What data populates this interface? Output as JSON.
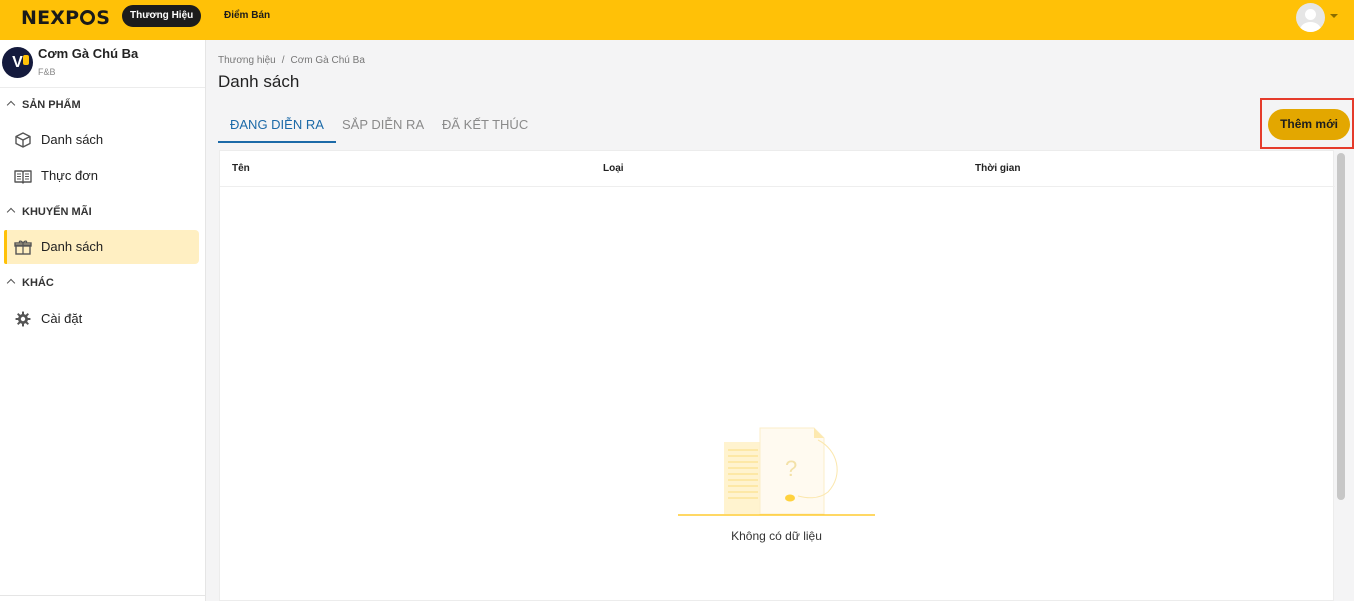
{
  "topbar": {
    "logo_left": "NEXP",
    "logo_right": "S",
    "nav": {
      "active": "Thương Hiệu",
      "other": "Điểm Bán"
    }
  },
  "brand": {
    "name": "Cơm Gà Chú Ba",
    "type": "F&B",
    "logo_letter": "V"
  },
  "sidebar": {
    "sections": [
      {
        "title": "SẢN PHẨM",
        "items": [
          {
            "label": "Danh sách",
            "icon": "cube-icon"
          },
          {
            "label": "Thực đơn",
            "icon": "book-icon"
          }
        ]
      },
      {
        "title": "KHUYẾN MÃI",
        "items": [
          {
            "label": "Danh sách",
            "icon": "gift-icon",
            "active": true
          }
        ]
      },
      {
        "title": "KHÁC",
        "items": [
          {
            "label": "Cài đặt",
            "icon": "gear-icon"
          }
        ]
      }
    ]
  },
  "breadcrumb": {
    "root": "Thương hiệu",
    "separator": "/",
    "current": "Cơm Gà Chú Ba"
  },
  "page": {
    "title": "Danh sách"
  },
  "tabs": [
    {
      "label": "ĐANG DIỄN RA",
      "active": true
    },
    {
      "label": "SẮP DIỄN RA",
      "active": false
    },
    {
      "label": "ĐÃ KẾT THÚC",
      "active": false
    }
  ],
  "actions": {
    "add_label": "Thêm mới"
  },
  "table": {
    "columns": [
      "Tên",
      "Loại",
      "Thời gian"
    ],
    "rows": [],
    "empty_text": "Không có dữ liệu"
  },
  "colors": {
    "topbar": "#ffc107",
    "accent": "#e3a700",
    "tab_active": "#1c6aa8",
    "highlight_box": "#e53b2b"
  }
}
